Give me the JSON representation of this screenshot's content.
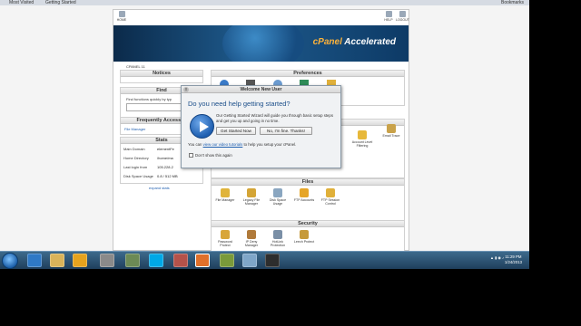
{
  "browser": {
    "bookmarks": [
      "Most Visited",
      "Getting Started"
    ],
    "bookmarks_right": "Bookmarks"
  },
  "cpanel": {
    "nav": [
      "HOME",
      "HELP",
      "LOGOUT"
    ],
    "banner_logo": "cPanel",
    "banner_sub": "Accelerated",
    "theme_label": "CPANEL 11",
    "notices": {
      "title": "Notices"
    },
    "find": {
      "title": "Find",
      "hint": "Find functions quickly by typ"
    },
    "frequently_accessed": {
      "title": "Frequently Accessed",
      "item": "File Manager"
    },
    "stats": {
      "title": "Stats",
      "rows": [
        {
          "label": "Main Domain",
          "value": "elementFe"
        },
        {
          "label": "Home Directory",
          "value": "/home/ma"
        },
        {
          "label": "Last login from",
          "value": "105.228.2"
        },
        {
          "label": "Disk Space Usage",
          "value": "0.8 / 512 MB"
        }
      ],
      "expand": "expand stats"
    },
    "preferences": {
      "title": "Preferences"
    },
    "partial_icons": [
      "Account Level Filtering",
      "Email Trace"
    ],
    "files": {
      "title": "Files",
      "items": [
        "File Manager",
        "Legacy File Manager",
        "Disk Space Usage",
        "FTP Accounts",
        "FTP Session Control"
      ]
    },
    "security": {
      "title": "Security",
      "items": [
        "Password Protect",
        "IP Deny Manager",
        "HotLink Protection",
        "Leech Protect"
      ]
    }
  },
  "dialog": {
    "title": "Welcome New User",
    "close": "x",
    "question": "Do you need help getting started?",
    "description": "Our Getting Started Wizard will guide you through basic setup steps and get you up and going in no time.",
    "btn_start": "Get Started Now",
    "btn_no": "No, I'm fine. Thanks!",
    "link_prefix": "You can ",
    "link_text": "view our video tutorials",
    "link_suffix": " to help you setup your cPanel.",
    "checkbox_label": "Don't show this again"
  },
  "taskbar": {
    "time": "11:29 PM",
    "date": "1/24/2013"
  }
}
